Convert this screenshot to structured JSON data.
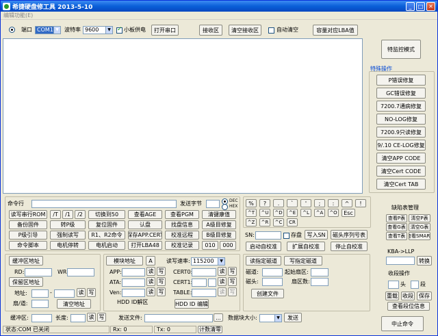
{
  "window": {
    "title": "希捷硬盘修工具  2013-5-10",
    "menu": "编辑功能(E)"
  },
  "top": {
    "port_label": "端口",
    "port_value": "COM1",
    "baud_label": "波特率",
    "baud_value": "9600",
    "small_board_label": "小板供电",
    "small_board_checked": true,
    "open_port": "打开串口",
    "receive_area": "接收区",
    "clear_receive": "清空接收区",
    "auto_clear_label": "自动清空",
    "capacity_lba": "容量对应LBA值"
  },
  "right_panel": {
    "special_mode": "特监控模式",
    "special_ops_label": "特殊操作",
    "ops": [
      "P错误修复",
      "GC错误修复",
      "7200.7通病修复",
      "NO-LOG修复",
      "7200.9只读修复",
      "9/.10 CE-LOG修复",
      "清空APP CODE",
      "清空Cert CODE",
      "清空Cert TAB"
    ]
  },
  "command": {
    "cmd_label": "命令行",
    "send_bytes_label": "发送字节",
    "dec": "DEC",
    "hex": "HEX",
    "row1": [
      "读写串行ROM",
      "/T",
      "/1",
      "/2",
      "切换到50",
      "查看AGE",
      "查看PGM",
      "清键康值"
    ],
    "row2": [
      "备份固件",
      "转P级",
      "复位固件",
      "认盘",
      "找盘信息",
      "A级目修复"
    ],
    "row3": [
      "P级引导",
      "强制读写",
      "R1、R2命令",
      "保存APP.CERT",
      "校准远程",
      "B级目修复"
    ],
    "row4": [
      "命令脚本",
      "电机停转",
      "电机启动",
      "打开LBA48",
      "校准记录",
      "010",
      "000"
    ]
  },
  "keypad": {
    "row1": [
      "%",
      "?",
      ".",
      "`",
      "'",
      ";",
      ":",
      "^",
      "!"
    ],
    "row2": [
      "^T",
      "^U",
      "^D",
      "^E",
      "^L",
      "^A",
      "^O",
      "Esc"
    ],
    "row3": [
      "^Z",
      "^R",
      "^C",
      "CR"
    ]
  },
  "sn": {
    "label": "SN:",
    "save_label": "存盘",
    "write_sn": "写入SN",
    "head_serial": "磁头序列号表",
    "start_calib": "启动自校准",
    "expand_calib": "扩展自校准",
    "stop_calib": "停止自校准"
  },
  "table_mgmt": {
    "label": "缺陷表管理",
    "buttons": [
      "查看P表",
      "清空P表",
      "查看G表",
      "清空G表",
      "查看T表",
      "查看SMART"
    ]
  },
  "buffer": {
    "btn1": "缓冲区地址",
    "rd": "RD:",
    "wr": "WR:",
    "btn2": "保留区地址",
    "addr": "地址:",
    "read": "读",
    "write": "写",
    "track": "扇/道:",
    "clear_addr": "清空地址"
  },
  "module": {
    "btn": "模块地址",
    "a": "A",
    "app": "APP:",
    "ata": "ATA:",
    "ven": "Ven:",
    "read": "读",
    "write": "写",
    "hdd_id": "HDD ID解区",
    "rw_speed": "读写速率:",
    "speed_value": "115200",
    "cert0": "CERT0:",
    "cert1": "CERT1:",
    "table": "TABLE:",
    "hdd_edit": "HDD ID 编辑"
  },
  "tracks": {
    "read_track": "读指定磁道",
    "write_track": "写指定磁道",
    "track_label": "磁道:",
    "start_sector": "起始扇区:",
    "head_label": "磁头:",
    "sector_count": "扇区数:",
    "create_file": "创建文件"
  },
  "kba": {
    "label": "KBA->LLP",
    "convert": "转换"
  },
  "sector_ops": {
    "label": "收段操作",
    "head": "头",
    "seg": "段",
    "reset": "重载",
    "collect": "收段",
    "save": "保存",
    "view": "查看段位信息"
  },
  "bottom": {
    "buffer_label": "缓冲区:",
    "length_label": "长度:",
    "read": "读",
    "write": "写",
    "send_file": "发送文件:",
    "browse": "...",
    "block_size": "数据块大小:",
    "send": "发送",
    "stop_cmd": "中止命令"
  },
  "statusbar": {
    "state": "状态:COM 已关闭",
    "rx": "Rx: 0",
    "tx": "Tx: 0",
    "clear_count": "计数清零"
  }
}
